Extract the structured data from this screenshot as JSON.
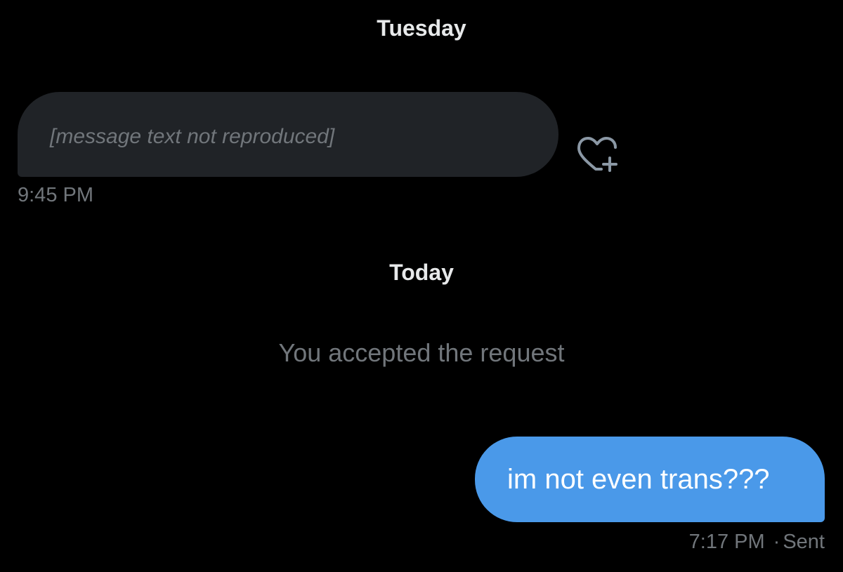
{
  "separators": {
    "first_day": "Tuesday",
    "second_day": "Today"
  },
  "messages": {
    "received": {
      "text_omitted_note": "[message text not reproduced]",
      "time": "9:45 PM"
    },
    "sent": {
      "text": "im not even trans???",
      "time": "7:17 PM",
      "status": "Sent"
    }
  },
  "system_note": "You accepted the request",
  "icons": {
    "react": "heart-plus-icon"
  },
  "colors": {
    "background": "#000000",
    "received_bubble": "#202327",
    "sent_bubble": "#4a99e9",
    "muted_text": "#71767b",
    "primary_text": "#e7e9ea"
  }
}
